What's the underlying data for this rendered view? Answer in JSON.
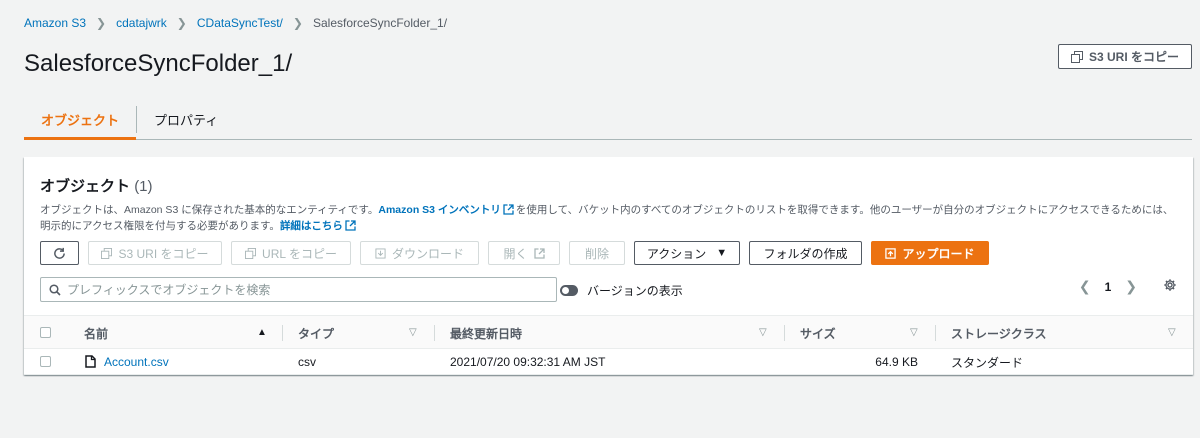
{
  "breadcrumb": {
    "items": [
      "Amazon S3",
      "cdatajwrk",
      "CDataSyncTest/"
    ],
    "current": "SalesforceSyncFolder_1/"
  },
  "page": {
    "title": "SalesforceSyncFolder_1/",
    "copy_uri_label": "S3 URI をコピー"
  },
  "tabs": [
    {
      "label": "オブジェクト",
      "active": true
    },
    {
      "label": "プロパティ",
      "active": false
    }
  ],
  "panel": {
    "title": "オブジェクト",
    "count": "(1)",
    "desc_part1": "オブジェクトは、Amazon S3 に保存された基本的なエンティティです。",
    "desc_link1": "Amazon S3 インベントリ",
    "desc_part2": "を使用して、バケット内のすべてのオブジェクトのリストを取得できます。他のユーザーが自分のオブジェクトにアクセスできるためには、明示的にアクセス権限を付与する必要があります。",
    "desc_link2": "詳細はこちら"
  },
  "toolbar": {
    "copy_s3_uri": "S3 URI をコピー",
    "copy_url": "URL をコピー",
    "download": "ダウンロード",
    "open": "開く",
    "delete": "削除",
    "actions": "アクション",
    "create_folder": "フォルダの作成",
    "upload": "アップロード"
  },
  "search": {
    "placeholder": "プレフィックスでオブジェクトを検索"
  },
  "versions_toggle": {
    "label": "バージョンの表示",
    "on": false
  },
  "pagination": {
    "page": "1"
  },
  "table": {
    "columns": [
      "名前",
      "タイプ",
      "最終更新日時",
      "サイズ",
      "ストレージクラス"
    ],
    "rows": [
      {
        "name": "Account.csv",
        "type": "csv",
        "modified": "2021/07/20 09:32:31 AM JST",
        "size": "64.9 KB",
        "storage": "スタンダード"
      }
    ]
  },
  "colors": {
    "accent": "#ec7211",
    "link": "#0073bb",
    "text": "#16191f",
    "muted": "#545b64"
  }
}
